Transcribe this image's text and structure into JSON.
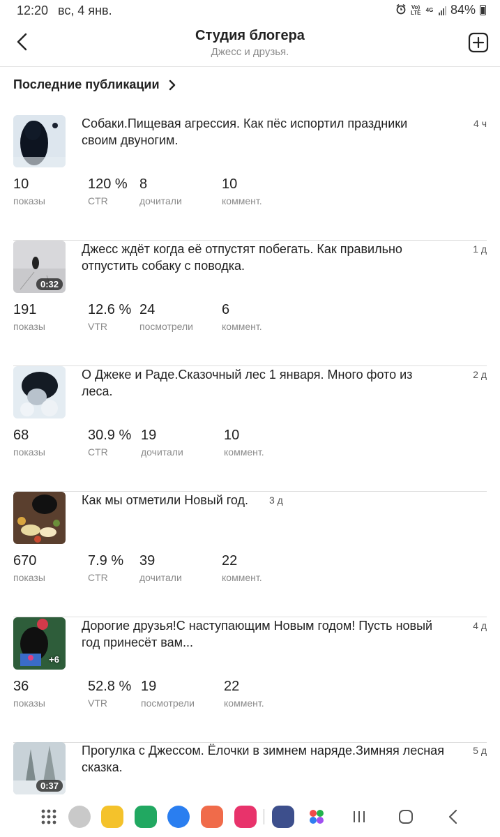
{
  "status": {
    "time": "12:20",
    "date": "вс, 4 янв.",
    "battery": "84%",
    "net1": "Vo) LTE",
    "net2": "4G"
  },
  "header": {
    "title": "Студия блогера",
    "subtitle": "Джесс и друзья."
  },
  "section": {
    "title": "Последние публикации"
  },
  "posts": [
    {
      "title": "Собаки.Пищевая агрессия. Как пёс испортил праздники своим двуногим.",
      "date": "4 ч",
      "stats": [
        {
          "value": "10",
          "label": "показы"
        },
        {
          "value": "120 %",
          "label": "CTR"
        },
        {
          "value": "8",
          "label": "дочитали"
        },
        {
          "value": "10",
          "label": "коммент."
        }
      ]
    },
    {
      "title": "Джесс ждёт когда её отпустят побегать. Как правильно отпустить собаку с поводка.",
      "date": "1 д",
      "duration": "0:32",
      "stats": [
        {
          "value": "191",
          "label": "показы"
        },
        {
          "value": "12.6 %",
          "label": "VTR"
        },
        {
          "value": "24",
          "label": "посмотрели"
        },
        {
          "value": "6",
          "label": "коммент."
        }
      ]
    },
    {
      "title": "О Джеке и Раде.Сказочный лес 1 января. Много фото из леса.",
      "date": "2 д",
      "stats": [
        {
          "value": "68",
          "label": "показы"
        },
        {
          "value": "30.9 %",
          "label": "CTR"
        },
        {
          "value": "19",
          "label": "дочитали"
        },
        {
          "value": "10",
          "label": "коммент."
        }
      ]
    },
    {
      "title": "Как мы отметили Новый год.",
      "date": "3 д",
      "stats": [
        {
          "value": "670",
          "label": "показы"
        },
        {
          "value": "7.9 %",
          "label": "CTR"
        },
        {
          "value": "39",
          "label": "дочитали"
        },
        {
          "value": "22",
          "label": "коммент."
        }
      ]
    },
    {
      "title": "Дорогие друзья!С наступающим Новым годом! Пусть новый год принесёт вам...",
      "date": "4 д",
      "more": "+6",
      "stats": [
        {
          "value": "36",
          "label": "показы"
        },
        {
          "value": "52.8 %",
          "label": "VTR"
        },
        {
          "value": "19",
          "label": "посмотрели"
        },
        {
          "value": "22",
          "label": "коммент."
        }
      ]
    },
    {
      "title": "Прогулка с Джессом. Ёлочки в зимнем наряде.Зимняя лесная сказка.",
      "date": "5 д",
      "duration": "0:37"
    }
  ]
}
